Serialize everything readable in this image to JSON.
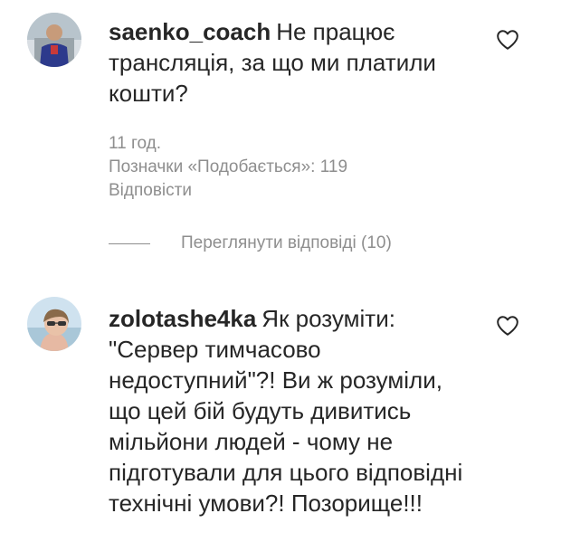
{
  "comments": [
    {
      "username": "saenko_coach",
      "text": "Не працює трансляція, за що ми платили кошти?",
      "time": "11 год.",
      "likes": "Позначки «Подобається»: 119",
      "reply_label": "Відповісти"
    },
    {
      "username": "zolotashe4ka",
      "text": "Як розуміти: \"Сервер тимчасово недоступний\"?! Ви ж розуміли, що цей бій будуть дивитись мільйони людей - чому не підготували для цього відповідні технічні умови?! Позорище!!!"
    }
  ],
  "view_replies": "Переглянути відповіді (10)",
  "colors": {
    "text": "#262626",
    "secondary": "#8e8e8e",
    "background": "#ffffff"
  },
  "icons": [
    "heart-icon"
  ]
}
